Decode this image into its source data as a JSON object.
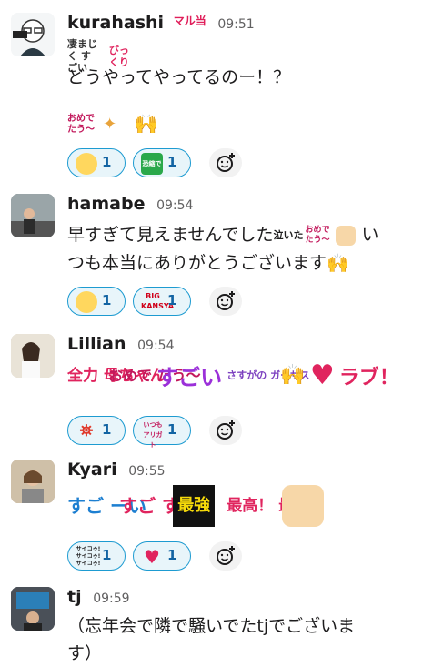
{
  "messages": [
    {
      "user": "kurahashi",
      "badge": "マル当",
      "time": "09:51",
      "stamps": [
        "凄まじく すごい",
        "びっ くり"
      ],
      "text": "どうやってやってるのー！？",
      "extra_stamps": [
        "おめで たう〜"
      ],
      "reactions": [
        {
          "emoji": "crying-face",
          "count": "1"
        },
        {
          "emoji": "恐縮です",
          "count": "1"
        }
      ]
    },
    {
      "user": "hamabe",
      "time": "09:54",
      "text_line1": "早すぎて見えませんでした",
      "stamp_a": "泣いた",
      "stamp_b": "おめで たう〜",
      "text_line1_end": "い",
      "text_line2": "つも本当にありがとうございます",
      "reactions": [
        {
          "emoji": "crying-face",
          "count": "1"
        },
        {
          "emoji": "BIG KANSYA",
          "count": "1"
        }
      ]
    },
    {
      "user": "Lillian",
      "time": "09:54",
      "stamp_zenryoku": "全力 母ちゃん",
      "stamp_omedetou": "おめで たう〜",
      "stamp_sugoi": "すごい",
      "stamp_sasuga": "さすがの ガーサス",
      "stamp_love": "ラブ！",
      "reactions": [
        {
          "emoji": "tokyo-tower",
          "count": "1"
        },
        {
          "emoji": "いつも アリガト",
          "count": "1"
        }
      ]
    },
    {
      "user": "Kyari",
      "time": "09:55",
      "stamp_sugoi1": "すご ーい",
      "stamp_sugoi2": "すご すぎ",
      "stamp_saikyou": "最強",
      "stamp_saikou": "最高！ 最高！",
      "reactions": [
        {
          "emoji": "サイコゥ! サイコゥ! サイコゥ!",
          "count": "1"
        },
        {
          "emoji": "heart",
          "count": "1"
        }
      ]
    },
    {
      "user": "tj",
      "time": "09:59",
      "text_line1": "（忘年会で隣で騒いでたtjでございま",
      "text_line2": "す）"
    }
  ],
  "add_reaction_icon": "add-emoji-icon",
  "colors": {
    "reaction_border": "#1d9bd1",
    "reaction_bg": "#e8f5fa",
    "count": "#1264a3",
    "time": "#616061"
  }
}
